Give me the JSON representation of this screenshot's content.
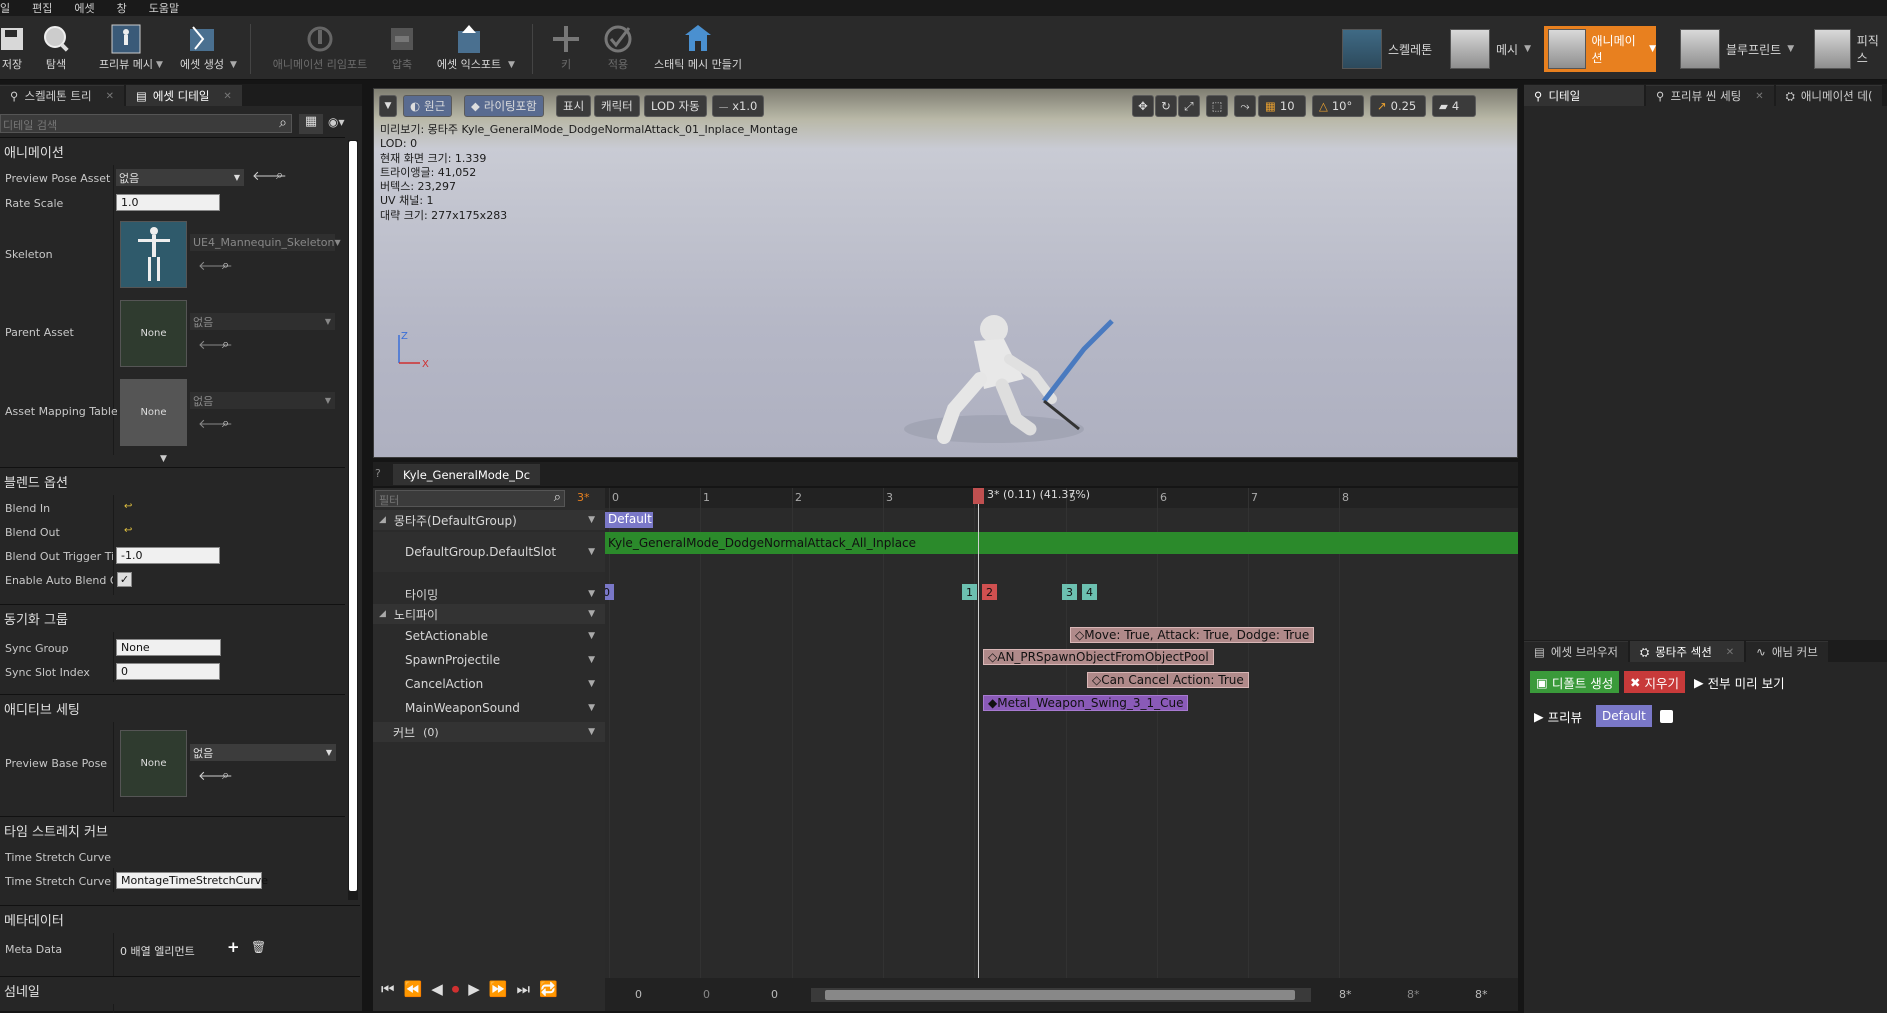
{
  "menu": [
    "일",
    "편집",
    "에셋",
    "창",
    "도움말"
  ],
  "toolbar": {
    "buttons": [
      {
        "label": "저장",
        "icon": "save-icon",
        "enabled": true
      },
      {
        "label": "탐색",
        "icon": "browse-icon",
        "enabled": true
      },
      {
        "label": "프리뷰 메시",
        "icon": "preview-mesh-icon",
        "enabled": true
      },
      {
        "label": "에셋 생성",
        "icon": "create-asset-icon",
        "enabled": true
      },
      {
        "label": "애니메이션 리임포트",
        "icon": "reimport-icon",
        "enabled": false
      },
      {
        "label": "압축",
        "icon": "compress-icon",
        "enabled": false
      },
      {
        "label": "에셋 익스포트",
        "icon": "export-asset-icon",
        "enabled": true
      },
      {
        "label": "키",
        "icon": "plus-icon",
        "enabled": false
      },
      {
        "label": "적용",
        "icon": "check-icon",
        "enabled": false
      },
      {
        "label": "스태틱 메시 만들기",
        "icon": "static-mesh-icon",
        "enabled": true
      }
    ],
    "modes": [
      {
        "label": "스켈레톤",
        "active": false
      },
      {
        "label": "메시",
        "active": false
      },
      {
        "label": "애니메이션",
        "active": true
      },
      {
        "label": "블루프린트",
        "active": false
      },
      {
        "label": "피직스",
        "active": false
      }
    ],
    "active_mode_color": "#e8801f"
  },
  "left_tabs": [
    {
      "label": "스켈레톤 트리",
      "active": false
    },
    {
      "label": "에셋 디테일",
      "active": true
    }
  ],
  "left_search_placeholder": "디테일 검색",
  "details": {
    "animation_section": "애니메이션",
    "preview_pose_asset_label": "Preview Pose Asset",
    "preview_pose_asset_value": "없음",
    "rate_scale_label": "Rate Scale",
    "rate_scale_value": "1.0",
    "skeleton_label": "Skeleton",
    "skeleton_value": "UE4_Mannequin_Skeleton",
    "parent_asset_label": "Parent Asset",
    "parent_asset_value": "없음",
    "parent_asset_thumb": "None",
    "asset_mapping_label": "Asset Mapping Table",
    "asset_mapping_value": "없음",
    "asset_mapping_thumb": "None",
    "blend_section": "블렌드 옵션",
    "blend_in_label": "Blend In",
    "blend_out_label": "Blend Out",
    "blend_out_trigger_label": "Blend Out Trigger Tim",
    "blend_out_trigger_value": "-1.0",
    "enable_auto_blend_label": "Enable Auto Blend Ou",
    "enable_auto_blend_checked": true,
    "sync_section": "동기화 그룹",
    "sync_group_label": "Sync Group",
    "sync_group_value": "None",
    "sync_slot_label": "Sync Slot Index",
    "sync_slot_value": "0",
    "additive_section": "애디티브 세팅",
    "preview_base_pose_label": "Preview Base Pose",
    "preview_base_pose_thumb": "None",
    "preview_base_pose_value": "없음",
    "time_stretch_section": "타임 스트레치 커브",
    "time_stretch_curve_label": "Time Stretch Curve",
    "time_stretch_curve_name_label": "Time Stretch Curve N",
    "time_stretch_curve_name_value": "MontageTimeStretchCurve",
    "metadata_section": "메타데이터",
    "meta_data_label": "Meta Data",
    "meta_data_value": "0 배열 엘리먼트",
    "thumbnail_section": "섬네일"
  },
  "viewport": {
    "buttons": {
      "perspective": "원근",
      "lighting": "라이팅포함",
      "show": "표시",
      "character": "캐릭터",
      "lod": "LOD 자동",
      "speed": "x1.0"
    },
    "grid_snap": "10",
    "rotation_snap": "10°",
    "scale_snap": "0.25",
    "camera_speed": "4",
    "info_lines": [
      "미리보기: 몽타주 Kyle_GeneralMode_DodgeNormalAttack_01_Inplace_Montage",
      "LOD: 0",
      "현재 화면 크기: 1.339",
      "트라이앵글: 41,052",
      "버텍스: 23,297",
      "UV 채널: 1",
      "대략 크기: 277x175x283"
    ]
  },
  "montage_tab": "Kyle_GeneralMode_Dc",
  "timeline": {
    "filter_placeholder": "필터",
    "frame_count_label": "3*",
    "scrub_label": "3* (0.11) (41.37%)",
    "ticks": [
      "0",
      "1",
      "2",
      "3",
      "4",
      "5",
      "6",
      "7",
      "8"
    ],
    "tracks": {
      "montage": "몽타주(DefaultGroup)",
      "slot": "DefaultGroup.DefaultSlot",
      "timing": "타이밍",
      "notifies": "노티파이",
      "n1": "SetActionable",
      "n2": "SpawnProjectile",
      "n3": "CancelAction",
      "n4": "MainWeaponSound",
      "curves": "커브",
      "curves_count": "(0)"
    },
    "section_label": "Default",
    "segment_label": "Kyle_GeneralMode_DodgeNormalAttack_All_Inplace",
    "timing_markers": [
      "0",
      "1",
      "2",
      "3",
      "4"
    ],
    "notify_events": [
      "Move: True, Attack: True, Dodge: True",
      "AN_PRSpawnObjectFromObjectPool",
      "Can Cancel Action: True",
      "Metal_Weapon_Swing_3_1_Cue"
    ],
    "bottom_fields": [
      "0",
      "0",
      "0",
      "8*",
      "8*",
      "8*"
    ]
  },
  "right_top_tabs": [
    {
      "label": "디테일",
      "active": true
    },
    {
      "label": "프리뷰 씬 세팅",
      "active": false
    },
    {
      "label": "애니메이션 데(",
      "active": false
    }
  ],
  "right_bottom_tabs": [
    {
      "label": "에셋 브라우저",
      "active": false
    },
    {
      "label": "몽타주 섹션",
      "active": true
    },
    {
      "label": "애님 커브",
      "active": false
    }
  ],
  "sections_panel": {
    "create_default": "디폴트 생성",
    "clear": "지우기",
    "preview_all": "전부 미리 보기",
    "preview": "프리뷰",
    "default_section": "Default"
  }
}
